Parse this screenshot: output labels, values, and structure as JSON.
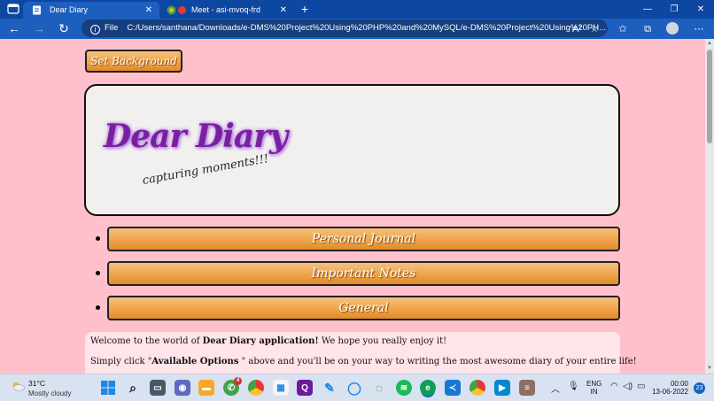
{
  "browser": {
    "tabs": [
      {
        "title": "Dear Diary",
        "active": true
      },
      {
        "title": "Meet - asi-mvoq-frd",
        "active": false
      }
    ],
    "url_scheme_label": "File",
    "url": "C:/Users/santhana/Downloads/e-DMS%20Project%20Using%20PHP%20and%20MySQL/e-DMS%20Project%20Using%20PH..."
  },
  "page": {
    "background_color": "#ffc0cb",
    "set_background_label": "Set Background",
    "hero": {
      "title": "Dear Diary",
      "tagline": "capturing moments!!!"
    },
    "menu": [
      {
        "label": "Personal Journal"
      },
      {
        "label": "Important Notes"
      },
      {
        "label": "General"
      }
    ],
    "welcome": {
      "line1_prefix": "Welcome to the world of ",
      "line1_bold": "Dear Diary application!",
      "line1_suffix": " We hope you really enjoy it!",
      "line2_prefix": "Simply click \"",
      "line2_bold": "Available Options",
      "line2_suffix": " \" above and you'll be on your way to writing the most awesome diary of your entire life!"
    }
  },
  "taskbar": {
    "weather_temp": "31°C",
    "weather_desc": "Mostly cloudy",
    "whatsapp_badge": "4",
    "language": "ENG",
    "region": "IN",
    "time": "00:00",
    "date": "13-06-2022",
    "notifications": "23"
  },
  "colors": {
    "accent_purple": "#7a1fa0",
    "button_orange": "#f0a34a",
    "chrome_blue": "#1d5fbf"
  }
}
